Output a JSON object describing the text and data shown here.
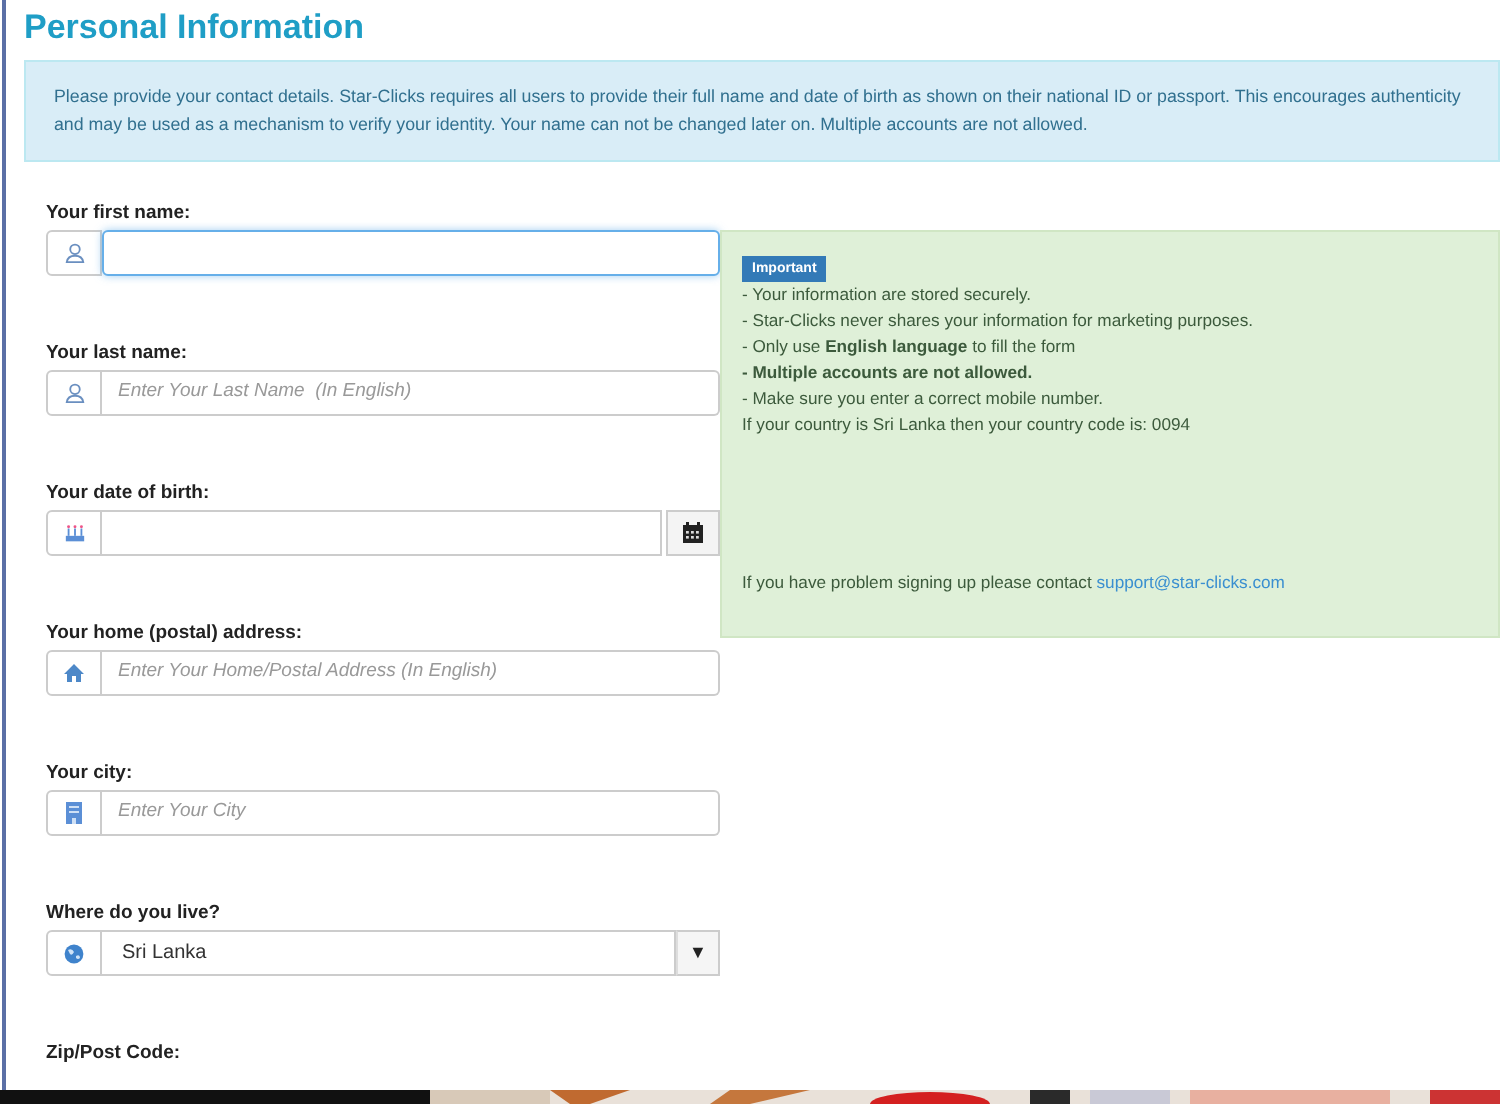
{
  "title": "Personal Information",
  "notice": "Please provide your contact details. Star-Clicks requires all users to provide their full name and date of birth as shown on their national ID or passport. This encourages authenticity and may be used as a mechanism to verify your identity. Your name can not be changed later on. Multiple accounts are not allowed.",
  "fields": [
    {
      "kind": "text",
      "label": "Your first name:",
      "focused": true
    },
    {
      "kind": "text",
      "label": "Your last name:",
      "placeholder": "Enter Your Last Name  (In English)",
      "focused": false
    },
    {
      "kind": "date",
      "label": "Your date of birth:",
      "focused": false
    },
    {
      "kind": "text",
      "label": "Your home (postal) address:",
      "placeholder": "Enter Your Home/Postal Address (In English)",
      "focused": false
    },
    {
      "kind": "text",
      "label": "Your city:",
      "placeholder": "Enter Your City",
      "focused": false
    },
    {
      "kind": "select",
      "label": "Where do you live?",
      "value": "Sri Lanka",
      "caret": "▼",
      "focused": false
    },
    {
      "kind": "label",
      "label": "Zip/Post Code:"
    }
  ],
  "info": {
    "badge": "Important",
    "lines": [
      {
        "text": "- Your information are stored securely.",
        "bold": false
      },
      {
        "text": "- Star-Clicks never shares your information for marketing purposes.",
        "bold": false
      },
      {
        "text": "- Only use **English language** to fill the form",
        "bold": false
      },
      {
        "text": "- Multiple accounts are not allowed.",
        "bold": true
      },
      {
        "text": "- Make sure you enter a correct mobile number.",
        "bold": false
      },
      {
        "text": "If your country is Sri Lanka then your country code is: 0094",
        "bold": false
      }
    ],
    "contact_text": "If you have problem signing up please contact",
    "contact_link": "support@star-clicks.com"
  }
}
